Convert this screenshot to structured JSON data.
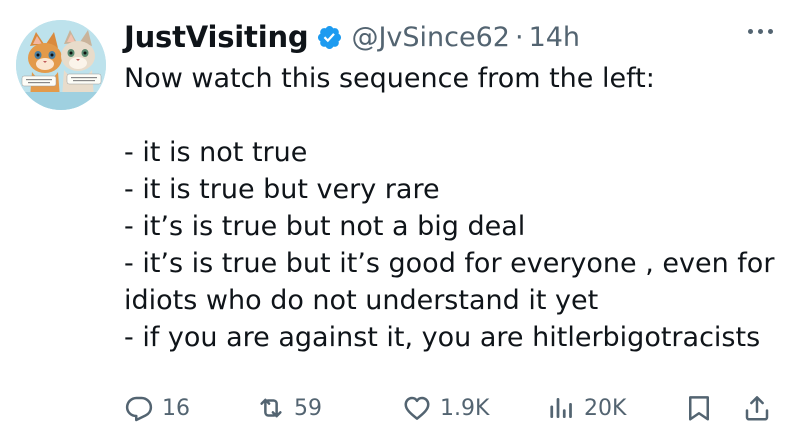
{
  "author": {
    "display_name": "JustVisiting",
    "handle": "@JvSince62",
    "separator": "·",
    "time": "14h",
    "verified": true,
    "avatar": "two-kittens-avatar"
  },
  "tweet": {
    "intro": "Now watch this sequence from the left:",
    "lines": [
      "- it is not true",
      "- it is true but very rare",
      "- it’s is true but not a big deal",
      "- it’s is true but it’s good for everyone , even for",
      "idiots who do not understand it yet",
      "- if you are against it, you are hitlerbigotracists"
    ]
  },
  "actions": {
    "replies": "16",
    "retweets": "59",
    "likes": "1.9K",
    "views": "20K"
  },
  "icons": {
    "reply": "reply-icon",
    "retweet": "retweet-icon",
    "like": "heart-icon",
    "views": "views-chart-icon",
    "bookmark": "bookmark-icon",
    "share": "share-icon",
    "more": "more-options-icon",
    "verified": "verified-badge-icon"
  },
  "colors": {
    "verified_blue": "#1d9bf0",
    "text": "#0f1419",
    "secondary": "#536471"
  }
}
